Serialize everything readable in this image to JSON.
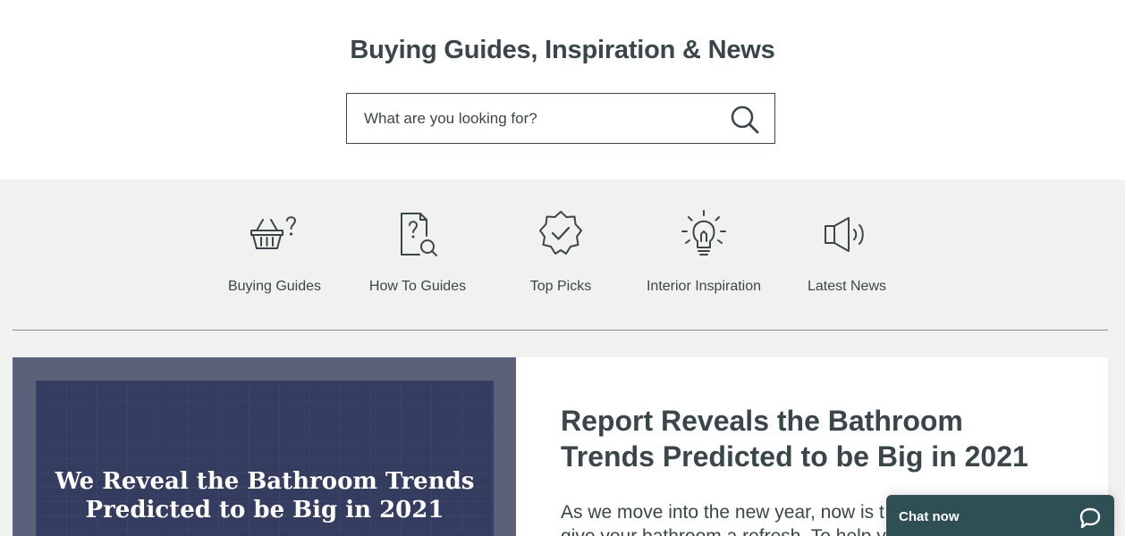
{
  "header": {
    "title": "Buying Guides, Inspiration & News"
  },
  "search": {
    "placeholder": "What are you looking for?",
    "icon": "search-icon"
  },
  "categories": [
    {
      "label": "Buying Guides",
      "icon": "basket-question-icon"
    },
    {
      "label": "How To Guides",
      "icon": "document-search-icon"
    },
    {
      "label": "Top Picks",
      "icon": "badge-check-icon"
    },
    {
      "label": "Interior Inspiration",
      "icon": "lightbulb-icon"
    },
    {
      "label": "Latest News",
      "icon": "megaphone-icon"
    }
  ],
  "featured": {
    "image_caption": "We Reveal the Bathroom Trends Predicted to be Big in 2021",
    "headline": "Report Reveals the Bathroom Trends Predicted to be Big in 2021",
    "excerpt_line1": "As we move into the new year, now is t",
    "excerpt_line2": "give your bathroom a refresh. To help y"
  },
  "chat": {
    "label": "Chat now",
    "icon": "chat-bubble-icon",
    "color": "#2e4f53"
  },
  "colors": {
    "text": "#3a474a",
    "band": "#f1f1ef",
    "image_frame": "#5c6079",
    "image_inner": "#343c60"
  }
}
